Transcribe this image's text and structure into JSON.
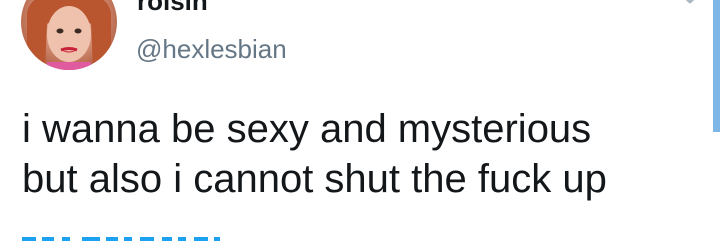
{
  "tweet": {
    "author": {
      "display_name": "roisin",
      "handle": "@hexlesbian",
      "avatar_icon": "profile-photo"
    },
    "text_lines": [
      "i wanna be sexy and mysterious",
      "but also i cannot shut the fuck up"
    ],
    "menu_icon": "chevron-down-icon"
  },
  "colors": {
    "text": "#14171a",
    "muted": "#657786",
    "accent": "#1da1f2",
    "scrollbar": "#7fb6e8"
  }
}
